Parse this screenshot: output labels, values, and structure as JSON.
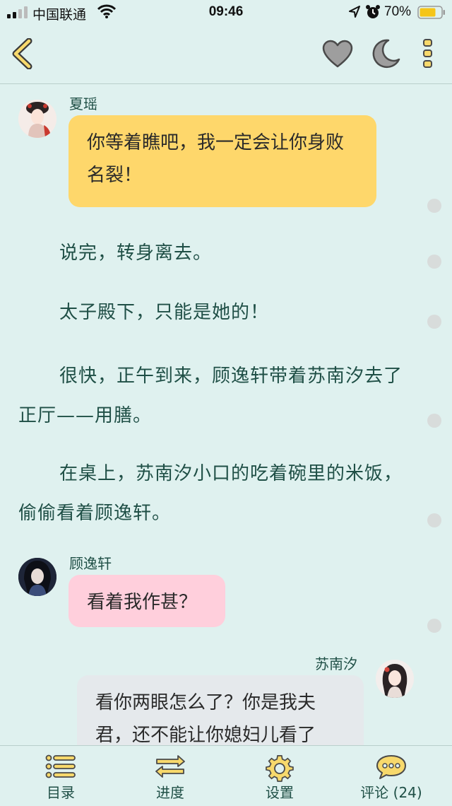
{
  "status_bar": {
    "carrier": "中国联通",
    "time": "09:46",
    "battery_percent": "70%"
  },
  "nav": {
    "back_icon": "chevron-left-icon",
    "favorite_icon": "heart-icon",
    "night_mode_icon": "moon-icon",
    "more_icon": "more-vertical-icon"
  },
  "messages": [
    {
      "speaker": "夏瑶",
      "text": "你等着瞧吧，我一定会让你身败名裂！",
      "bubble_color": "#fed76b"
    },
    {
      "speaker": "顾逸轩",
      "text": "看着我作甚？",
      "bubble_color": "#ffcfdc"
    },
    {
      "speaker": "苏南汐",
      "text": "看你两眼怎么了？你是我夫君，还不能让你媳妇儿看了",
      "bubble_color": "#e5e9ec"
    }
  ],
  "paragraphs": [
    "说完，转身离去。",
    "太子殿下，只能是她的！",
    "很快，正午到来，顾逸轩带着苏南汐去了正厅——用膳。",
    "在桌上，苏南汐小口的吃着碗里的米饭，偷偷看着顾逸轩。"
  ],
  "toolbar": {
    "items": [
      {
        "label": "目录",
        "icon": "list-icon"
      },
      {
        "label": "进度",
        "icon": "swap-arrows-icon"
      },
      {
        "label": "设置",
        "icon": "gear-icon"
      },
      {
        "label": "评论 (24)",
        "icon": "comment-bubble-icon"
      }
    ]
  },
  "colors": {
    "background": "#dff1ef",
    "text": "#1f4f46",
    "icon_yellow": "#f7d96c",
    "icon_gray": "#9e9e9e"
  }
}
